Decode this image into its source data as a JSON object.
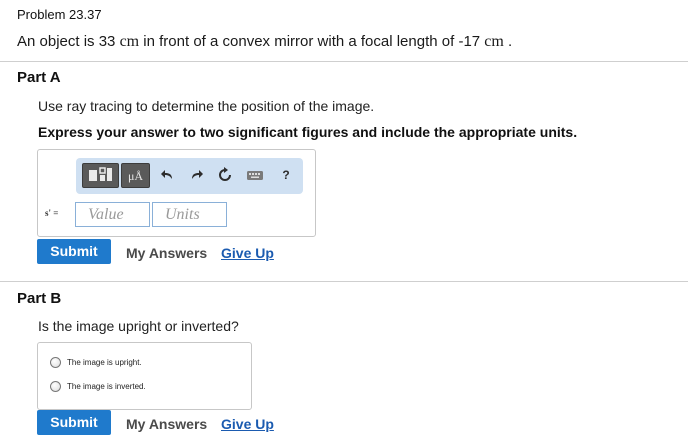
{
  "problem": {
    "number": "Problem 23.37",
    "statement_prefix": "An object is 33",
    "unit1": "cm",
    "statement_middle": "in front of a convex mirror with a focal length of -17",
    "unit2": "cm",
    "statement_suffix": "."
  },
  "partA": {
    "title": "Part A",
    "instruction": "Use ray tracing to determine the position of the image.",
    "emphasis": "Express your answer to two significant figures and include the appropriate units.",
    "toolbar": {
      "template_icon": "template-icon",
      "units_button_label": "μÅ",
      "undo_icon": "undo-icon",
      "redo_icon": "redo-icon",
      "reset_icon": "reset-icon",
      "keyboard_icon": "keyboard-icon",
      "help_label": "?"
    },
    "variable_label": "s' =",
    "value_placeholder": "Value",
    "units_placeholder": "Units",
    "submit_label": "Submit",
    "my_answers_label": "My Answers",
    "give_up_label": "Give Up"
  },
  "partB": {
    "title": "Part B",
    "question": "Is the image upright or inverted?",
    "choices": [
      "The image is upright.",
      "The image is inverted."
    ],
    "submit_label": "Submit",
    "my_answers_label": "My Answers",
    "give_up_label": "Give Up"
  },
  "colors": {
    "submit_bg": "#1f7acc",
    "toolbar_bg": "#cfe0f2",
    "link": "#1b5bb0"
  }
}
